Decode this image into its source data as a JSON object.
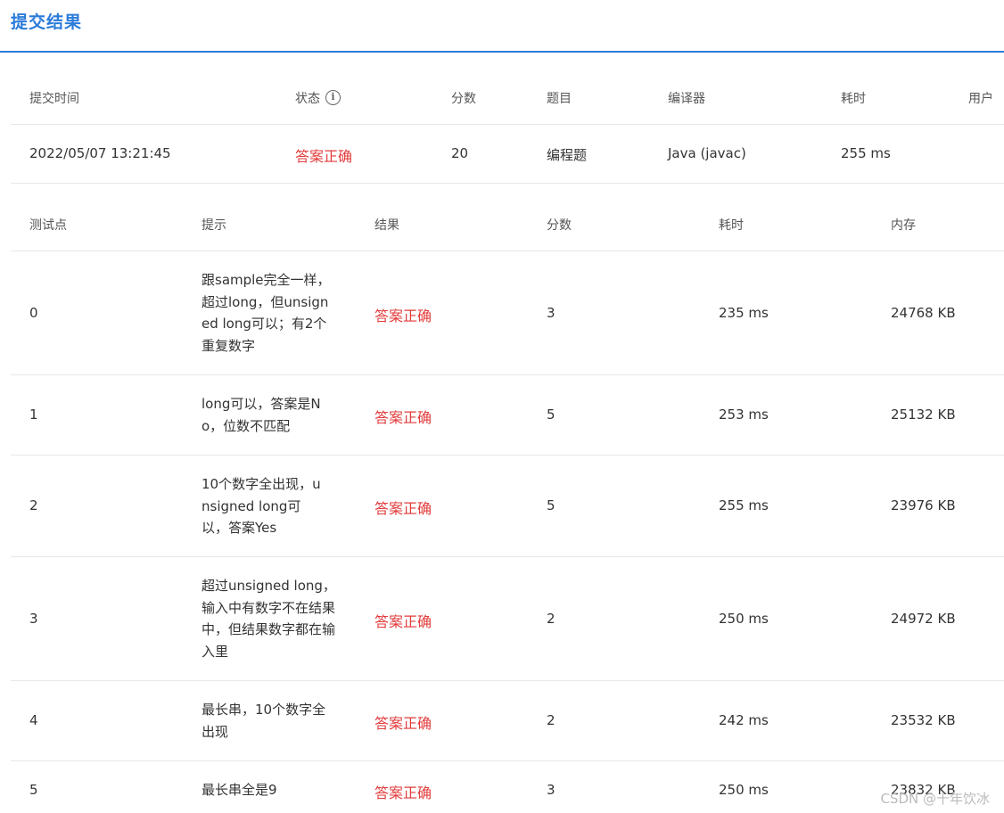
{
  "tab": {
    "title": "提交结果"
  },
  "submission": {
    "headers": {
      "time": "提交时间",
      "status": "状态",
      "score": "分数",
      "problem": "题目",
      "compiler": "编译器",
      "elapsed": "耗时",
      "user": "用户"
    },
    "row": {
      "time": "2022/05/07 13:21:45",
      "status": "答案正确",
      "score": "20",
      "problem": "编程题",
      "compiler": "Java (javac)",
      "elapsed": "255 ms",
      "user": ""
    }
  },
  "testcases": {
    "headers": {
      "id": "测试点",
      "hint": "提示",
      "result": "结果",
      "score": "分数",
      "elapsed": "耗时",
      "memory": "内存"
    },
    "rows": [
      {
        "id": "0",
        "hint": "跟sample完全一样，超过long，但unsigned long可以；有2个重复数字",
        "result": "答案正确",
        "score": "3",
        "elapsed": "235 ms",
        "memory": "24768 KB"
      },
      {
        "id": "1",
        "hint": "long可以，答案是No，位数不匹配",
        "result": "答案正确",
        "score": "5",
        "elapsed": "253 ms",
        "memory": "25132 KB"
      },
      {
        "id": "2",
        "hint": "10个数字全出现，unsigned long可以，答案Yes",
        "result": "答案正确",
        "score": "5",
        "elapsed": "255 ms",
        "memory": "23976 KB"
      },
      {
        "id": "3",
        "hint": "超过unsigned long，输入中有数字不在结果中，但结果数字都在输入里",
        "result": "答案正确",
        "score": "2",
        "elapsed": "250 ms",
        "memory": "24972 KB"
      },
      {
        "id": "4",
        "hint": "最长串，10个数字全出现",
        "result": "答案正确",
        "score": "2",
        "elapsed": "242 ms",
        "memory": "23532 KB"
      },
      {
        "id": "5",
        "hint": "最长串全是9",
        "result": "答案正确",
        "score": "3",
        "elapsed": "250 ms",
        "memory": "23832 KB"
      }
    ]
  },
  "watermark": "CSDN @十年饮冰",
  "colors": {
    "accent": "#2b7bd9",
    "success_text": "#e23b3b"
  }
}
